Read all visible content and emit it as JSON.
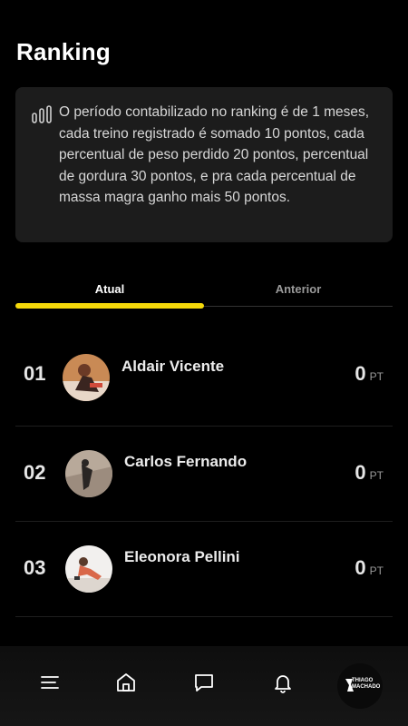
{
  "page": {
    "title": "Ranking"
  },
  "info": {
    "icon": "bar-chart-icon",
    "text": "O período contabilizado no ranking é de 1 meses, cada treino registrado é somado 10 pontos, cada percentual de peso perdido 20 pontos, percentual de gordura 30 pontos, e pra cada percentual de massa magra ganho mais 50 pontos."
  },
  "tabs": [
    {
      "label": "Atual",
      "active": true
    },
    {
      "label": "Anterior",
      "active": false
    }
  ],
  "accent_color": "#f5d90a",
  "ranking": [
    {
      "position": "01",
      "name": "Aldair Vicente",
      "points": "0",
      "unit": "PT"
    },
    {
      "position": "02",
      "name": "Carlos Fernando",
      "points": "0",
      "unit": "PT"
    },
    {
      "position": "03",
      "name": "Eleonora Pellini",
      "points": "0",
      "unit": "PT"
    }
  ],
  "bottom_nav": [
    {
      "icon": "menu-icon"
    },
    {
      "icon": "home-icon"
    },
    {
      "icon": "chat-icon"
    },
    {
      "icon": "bell-icon"
    },
    {
      "icon": "logo-icon",
      "text": "THIAGO MACHADO"
    }
  ]
}
